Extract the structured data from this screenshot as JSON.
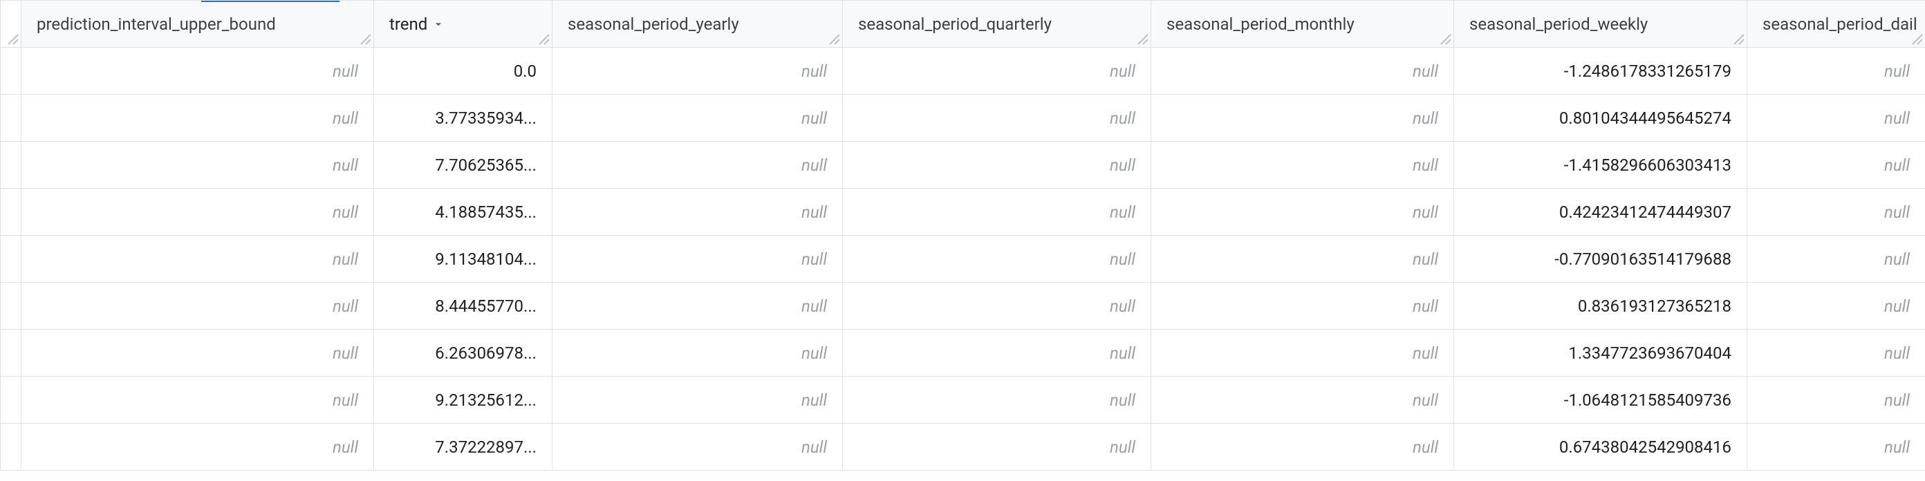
{
  "null_label": "null",
  "columns": [
    {
      "key": "prediction_interval_upper_bound",
      "label": "prediction_interval_upper_bound",
      "sorted": false
    },
    {
      "key": "trend",
      "label": "trend",
      "sorted": true,
      "sort_dir": "desc"
    },
    {
      "key": "seasonal_period_yearly",
      "label": "seasonal_period_yearly",
      "sorted": false
    },
    {
      "key": "seasonal_period_quarterly",
      "label": "seasonal_period_quarterly",
      "sorted": false
    },
    {
      "key": "seasonal_period_monthly",
      "label": "seasonal_period_monthly",
      "sorted": false
    },
    {
      "key": "seasonal_period_weekly",
      "label": "seasonal_period_weekly",
      "sorted": false
    },
    {
      "key": "seasonal_period_daily",
      "label": "seasonal_period_dail",
      "sorted": false
    }
  ],
  "rows": [
    {
      "prediction_interval_upper_bound": null,
      "trend": "0.0",
      "seasonal_period_yearly": null,
      "seasonal_period_quarterly": null,
      "seasonal_period_monthly": null,
      "seasonal_period_weekly": "-1.2486178331265179",
      "seasonal_period_daily": null
    },
    {
      "prediction_interval_upper_bound": null,
      "trend": "3.77335934...",
      "seasonal_period_yearly": null,
      "seasonal_period_quarterly": null,
      "seasonal_period_monthly": null,
      "seasonal_period_weekly": "0.80104344495645274",
      "seasonal_period_daily": null
    },
    {
      "prediction_interval_upper_bound": null,
      "trend": "7.70625365...",
      "seasonal_period_yearly": null,
      "seasonal_period_quarterly": null,
      "seasonal_period_monthly": null,
      "seasonal_period_weekly": "-1.4158296606303413",
      "seasonal_period_daily": null
    },
    {
      "prediction_interval_upper_bound": null,
      "trend": "4.18857435...",
      "seasonal_period_yearly": null,
      "seasonal_period_quarterly": null,
      "seasonal_period_monthly": null,
      "seasonal_period_weekly": "0.42423412474449307",
      "seasonal_period_daily": null
    },
    {
      "prediction_interval_upper_bound": null,
      "trend": "9.11348104...",
      "seasonal_period_yearly": null,
      "seasonal_period_quarterly": null,
      "seasonal_period_monthly": null,
      "seasonal_period_weekly": "-0.77090163514179688",
      "seasonal_period_daily": null
    },
    {
      "prediction_interval_upper_bound": null,
      "trend": "8.44455770...",
      "seasonal_period_yearly": null,
      "seasonal_period_quarterly": null,
      "seasonal_period_monthly": null,
      "seasonal_period_weekly": "0.836193127365218",
      "seasonal_period_daily": null
    },
    {
      "prediction_interval_upper_bound": null,
      "trend": "6.26306978...",
      "seasonal_period_yearly": null,
      "seasonal_period_quarterly": null,
      "seasonal_period_monthly": null,
      "seasonal_period_weekly": "1.3347723693670404",
      "seasonal_period_daily": null
    },
    {
      "prediction_interval_upper_bound": null,
      "trend": "9.21325612...",
      "seasonal_period_yearly": null,
      "seasonal_period_quarterly": null,
      "seasonal_period_monthly": null,
      "seasonal_period_weekly": "-1.0648121585409736",
      "seasonal_period_daily": null
    },
    {
      "prediction_interval_upper_bound": null,
      "trend": "7.37222897...",
      "seasonal_period_yearly": null,
      "seasonal_period_quarterly": null,
      "seasonal_period_monthly": null,
      "seasonal_period_weekly": "0.67438042542908416",
      "seasonal_period_daily": null
    }
  ],
  "colors": {
    "sort_icon": "#5f6368",
    "resize": "#bdc1c6",
    "null": "#9aa0a6",
    "accent": "#1a73e8"
  }
}
